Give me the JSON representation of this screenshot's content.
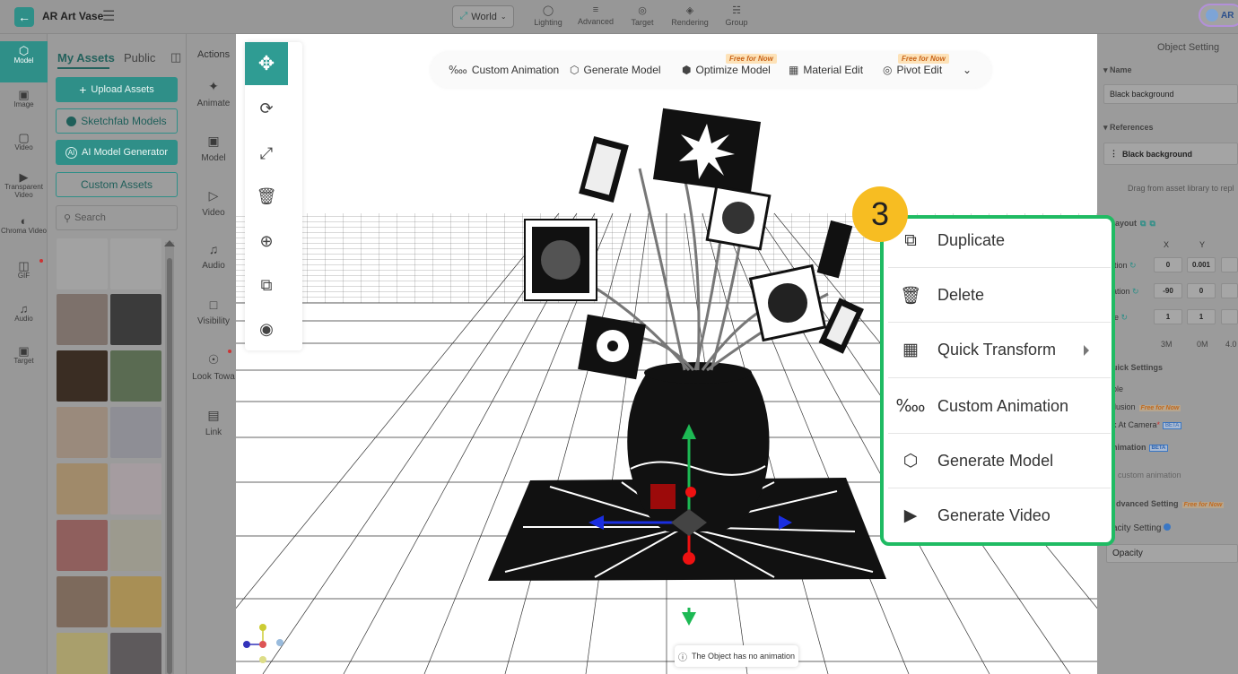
{
  "app": {
    "title": "AR Art Vase",
    "back_icon": "back-arrow-icon",
    "menu_icon": "hamburger-icon"
  },
  "topbar": {
    "world_select": "World",
    "nav": [
      {
        "label": "Lighting",
        "icon": "bulb-icon"
      },
      {
        "label": "Advanced",
        "icon": "sliders-icon"
      },
      {
        "label": "Target",
        "icon": "target-icon"
      },
      {
        "label": "Rendering",
        "icon": "paint-bucket-icon"
      },
      {
        "label": "Group",
        "icon": "group-icon"
      }
    ],
    "user_badge": "AR"
  },
  "left_rail": [
    {
      "label": "Model",
      "icon": "cube-icon",
      "active": true
    },
    {
      "label": "Image",
      "icon": "image-icon"
    },
    {
      "label": "Video",
      "icon": "ar-video-icon"
    },
    {
      "label": "Transparent Video",
      "icon": "transparent-video-icon"
    },
    {
      "label": "Chroma Video",
      "icon": "chroma-video-icon"
    },
    {
      "label": "GIF",
      "icon": "gif-icon"
    },
    {
      "label": "Audio",
      "icon": "music-icon"
    },
    {
      "label": "Target",
      "icon": "target-scan-icon"
    }
  ],
  "assets": {
    "tabs": [
      "My Assets",
      "Public"
    ],
    "upload_label": "Upload Assets",
    "sketchfab_label": "Sketchfab Models",
    "ai_label": "AI Model Generator",
    "custom_label": "Custom Assets",
    "search_placeholder": "Search"
  },
  "actions": {
    "title": "Actions",
    "items": [
      {
        "label": "Animate",
        "icon": "sparkle-icon"
      },
      {
        "label": "Model",
        "icon": "model-scan-icon"
      },
      {
        "label": "Video",
        "icon": "video-play-icon"
      },
      {
        "label": "Audio",
        "icon": "music-note-icon"
      },
      {
        "label": "Visibility",
        "icon": "visibility-icon"
      },
      {
        "label": "Look Towa",
        "icon": "look-toward-icon"
      },
      {
        "label": "Link",
        "icon": "link-window-icon"
      }
    ]
  },
  "viewport_toolbar": {
    "items": [
      {
        "label": "Custom Animation",
        "icon": "custom-animation-icon"
      },
      {
        "label": "Generate Model",
        "icon": "hexagon-cube-icon"
      },
      {
        "label": "Optimize Model",
        "icon": "optimize-icon",
        "tag": "Free for Now"
      },
      {
        "label": "Material Edit",
        "icon": "material-icon"
      },
      {
        "label": "Pivot Edit",
        "icon": "pivot-icon",
        "tag": "Free for Now"
      }
    ]
  },
  "status": {
    "no_animation": "The Object has no animation"
  },
  "context_menu": {
    "step": "3",
    "items": [
      {
        "label": "Duplicate",
        "icon": "duplicate-icon"
      },
      {
        "label": "Delete",
        "icon": "trash-icon"
      },
      {
        "label": "Quick Transform",
        "icon": "quick-transform-icon",
        "has_submenu": true
      },
      {
        "label": "Custom Animation",
        "icon": "custom-animation-icon"
      },
      {
        "label": "Generate Model",
        "icon": "hexagon-cube-icon"
      },
      {
        "label": "Generate Video",
        "icon": "generate-video-icon"
      }
    ]
  },
  "object_setting": {
    "title": "Object Setting",
    "name_label": "Name",
    "name_value": "Black background",
    "references_label": "References",
    "reference_value": "Black background",
    "drag_hint": "Drag from asset library to repl",
    "layout_label": "ayout",
    "col_x": "X",
    "col_y": "Y",
    "position_label": "ition",
    "position": [
      "0",
      "0.001"
    ],
    "rotation_label": "ation",
    "rotation": [
      "-90",
      "0"
    ],
    "scale_label": "le",
    "scale": [
      "1",
      "1"
    ],
    "size_labels": [
      "3M",
      "0M",
      "4.0"
    ],
    "quick_settings": "uick Settings",
    "qs_items": [
      "ble",
      "llusion",
      "k At Camera"
    ],
    "qs_free": "Free for Now",
    "beta": "BETA",
    "animation_label": "nimation",
    "animation_hint": "custom animation",
    "advanced_label": "dvanced Setting",
    "advanced_free": "Free for Now",
    "opacity_setting": "acity Setting",
    "opacity_label": "Opacity"
  }
}
